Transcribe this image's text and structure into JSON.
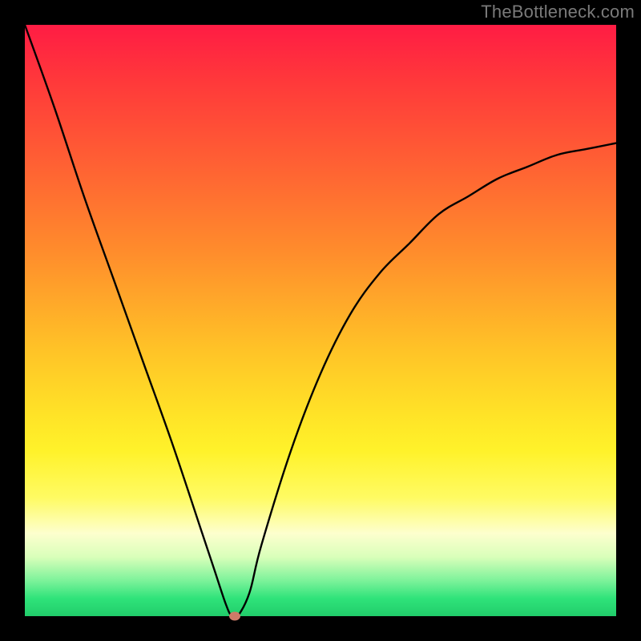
{
  "watermark": "TheBottleneck.com",
  "colors": {
    "frame": "#000000",
    "curve_stroke": "#000000",
    "marker_fill": "#cd7b68",
    "gradient_top": "#ff1c44",
    "gradient_bottom": "#21cc6a"
  },
  "chart_data": {
    "type": "line",
    "title": "",
    "xlabel": "",
    "ylabel": "",
    "xlim": [
      0,
      100
    ],
    "ylim": [
      0,
      100
    ],
    "grid": false,
    "series": [
      {
        "name": "bottleneck-curve",
        "x": [
          0,
          5,
          10,
          15,
          20,
          25,
          30,
          32,
          34,
          35,
          36,
          38,
          40,
          45,
          50,
          55,
          60,
          65,
          70,
          75,
          80,
          85,
          90,
          95,
          100
        ],
        "y": [
          100,
          86,
          71,
          57,
          43,
          29,
          14,
          8,
          2,
          0,
          0,
          4,
          12,
          28,
          41,
          51,
          58,
          63,
          68,
          71,
          74,
          76,
          78,
          79,
          80
        ]
      }
    ],
    "marker": {
      "x": 35.5,
      "y": 0
    },
    "legend": false
  }
}
